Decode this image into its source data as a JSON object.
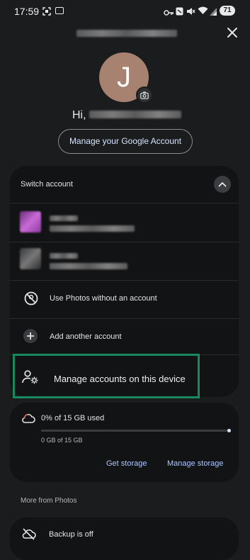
{
  "status_bar": {
    "time": "17:59",
    "battery": "71",
    "icons": [
      "screenshot-icon",
      "message-icon",
      "key-icon",
      "nfc-icon",
      "mute-icon",
      "wifi-icon",
      "signal-icon"
    ]
  },
  "header": {
    "avatar_initial": "J",
    "greeting": "Hi,",
    "manage_account_button": "Manage your Google Account"
  },
  "switch_account": {
    "label": "Switch account",
    "actions": [
      {
        "label": "Use Photos without an account",
        "icon": "no-account-icon"
      },
      {
        "label": "Add another account",
        "icon": "plus-icon"
      },
      {
        "label": "Manage accounts on this device",
        "icon": "manage-accounts-icon"
      }
    ]
  },
  "storage": {
    "used_text": "0% of 15 GB used",
    "usage_detail": "0 GB of 15 GB",
    "progress": 0.0,
    "get_storage": "Get storage",
    "manage_storage": "Manage storage"
  },
  "more_section": {
    "title": "More from Photos",
    "backup_label": "Backup is off"
  },
  "colors": {
    "background": "#1b1c1e",
    "card": "#121314",
    "accent_link": "#aec7ff",
    "highlight_border": "#168a5e",
    "avatar_bg": "#a78271"
  }
}
